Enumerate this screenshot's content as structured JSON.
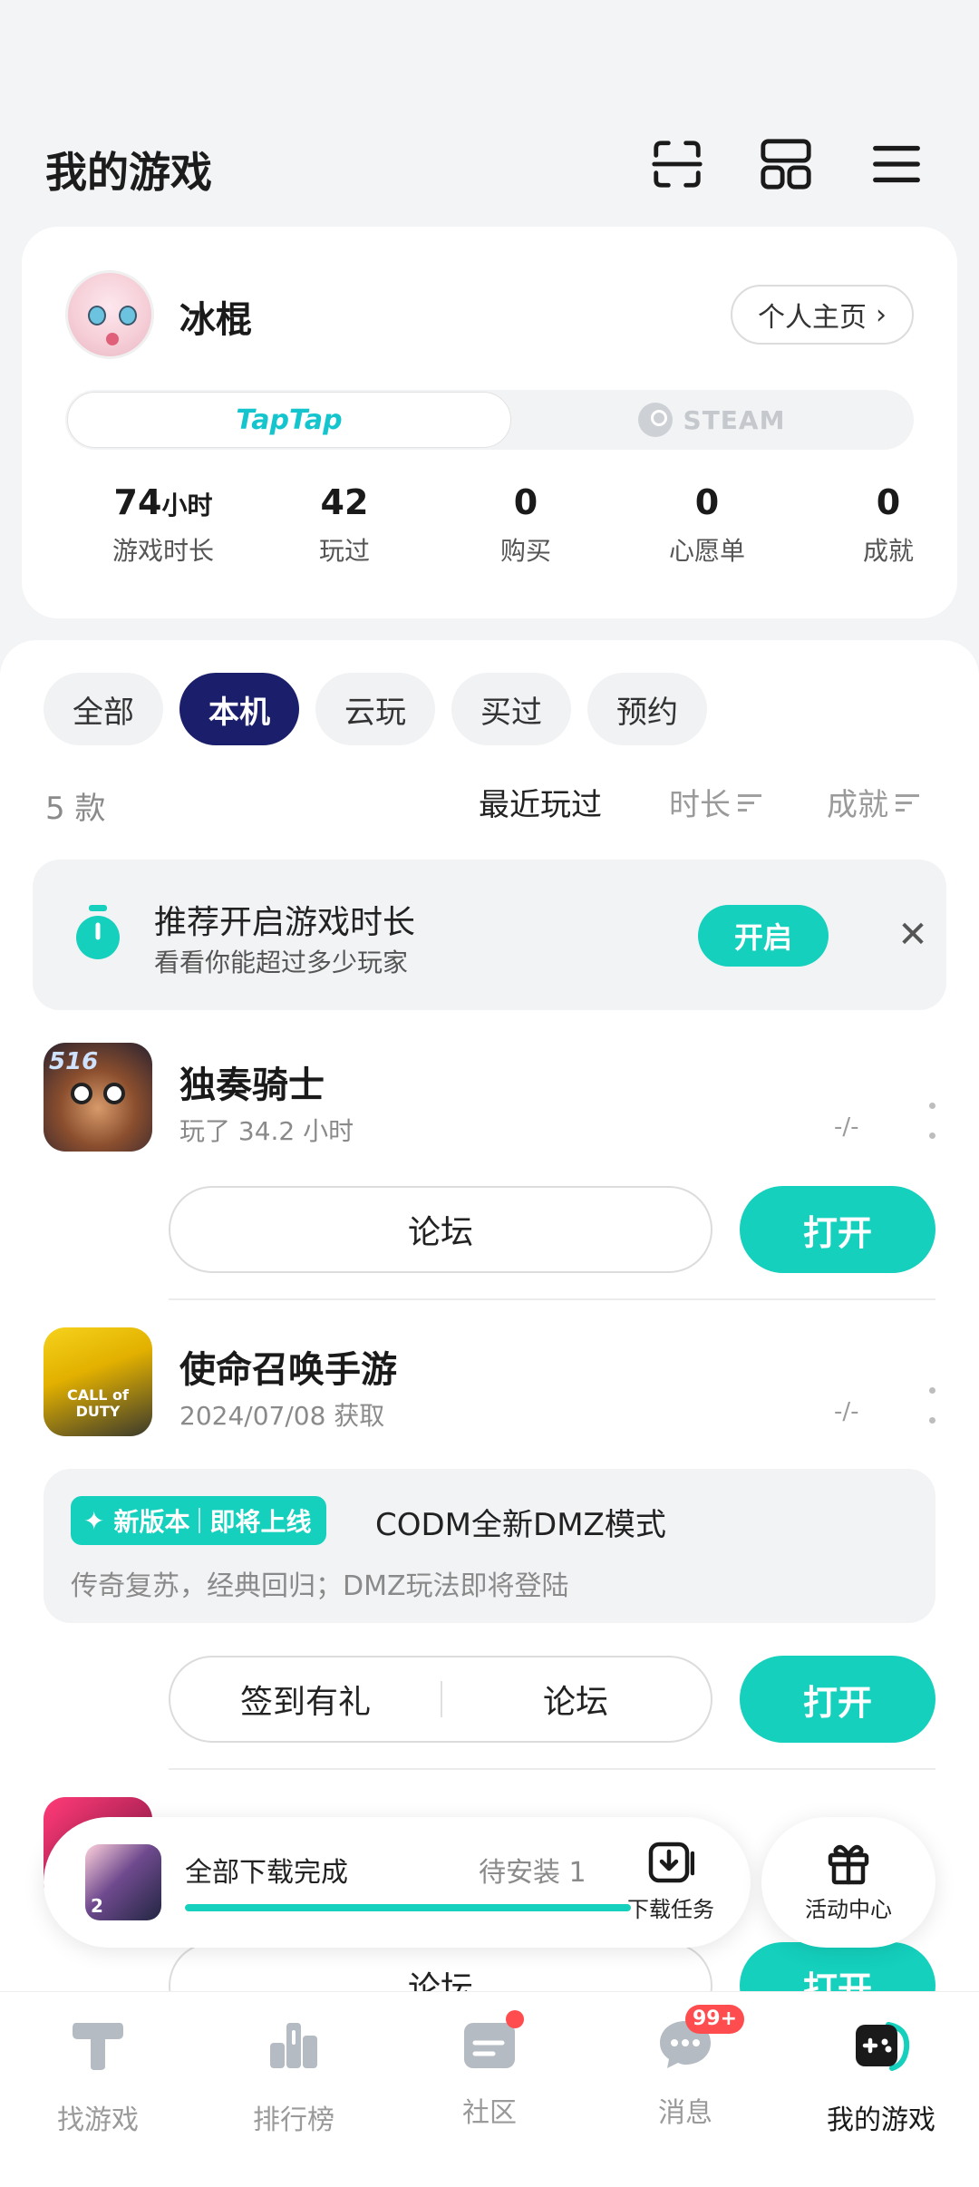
{
  "header": {
    "title": "我的游戏"
  },
  "profile": {
    "username": "冰棍",
    "profile_link": "个人主页",
    "platforms": [
      "TapTap",
      "STEAM"
    ],
    "stats": [
      {
        "value": "74",
        "unit": "小时",
        "label": "游戏时长"
      },
      {
        "value": "42",
        "unit": "",
        "label": "玩过"
      },
      {
        "value": "0",
        "unit": "",
        "label": "购买"
      },
      {
        "value": "0",
        "unit": "",
        "label": "心愿单"
      },
      {
        "value": "0",
        "unit": "",
        "label": "成就"
      }
    ]
  },
  "filters": [
    "全部",
    "本机",
    "云玩",
    "买过",
    "预约"
  ],
  "active_filter": "本机",
  "list": {
    "count": "5 款",
    "sort": [
      "最近玩过",
      "时长",
      "成就"
    ]
  },
  "tip": {
    "title": "推荐开启游戏时长",
    "subtitle": "看看你能超过多少玩家",
    "button": "开启"
  },
  "games": [
    {
      "name": "独奏骑士",
      "meta": "玩了 34.2 小时",
      "rating": "-/-",
      "forum": "论坛",
      "open": "打开"
    },
    {
      "name": "使命召唤手游",
      "meta": "2024/07/08 获取",
      "rating": "-/-",
      "checkin": "签到有礼",
      "forum": "论坛",
      "open": "打开",
      "news": {
        "badge_left": "新版本",
        "badge_right": "即将上线",
        "title": "CODM全新DMZ模式",
        "subtitle": "传奇复苏，经典回归；DMZ玩法即将登陆"
      }
    },
    {
      "forum": "论坛",
      "open": "打开"
    }
  ],
  "game_icon_text": {
    "g1": "516",
    "g2": "CALL of DUTY"
  },
  "download": {
    "title": "全部下载完成",
    "pending": "待安装 1",
    "progress": 1.0,
    "task_label": "下载任务",
    "thumb_text": "2"
  },
  "activity": {
    "label": "活动中心"
  },
  "nav": [
    {
      "label": "找游戏",
      "icon": "find-games-icon"
    },
    {
      "label": "排行榜",
      "icon": "ranking-icon"
    },
    {
      "label": "社区",
      "icon": "community-icon"
    },
    {
      "label": "消息",
      "icon": "message-icon",
      "badge": "99+"
    },
    {
      "label": "我的游戏",
      "icon": "my-games-icon"
    }
  ],
  "colors": {
    "accent": "#14d0bd",
    "active_chip": "#1b1f6b",
    "badge": "#ff4d4f",
    "background": "#f3f4f6"
  }
}
